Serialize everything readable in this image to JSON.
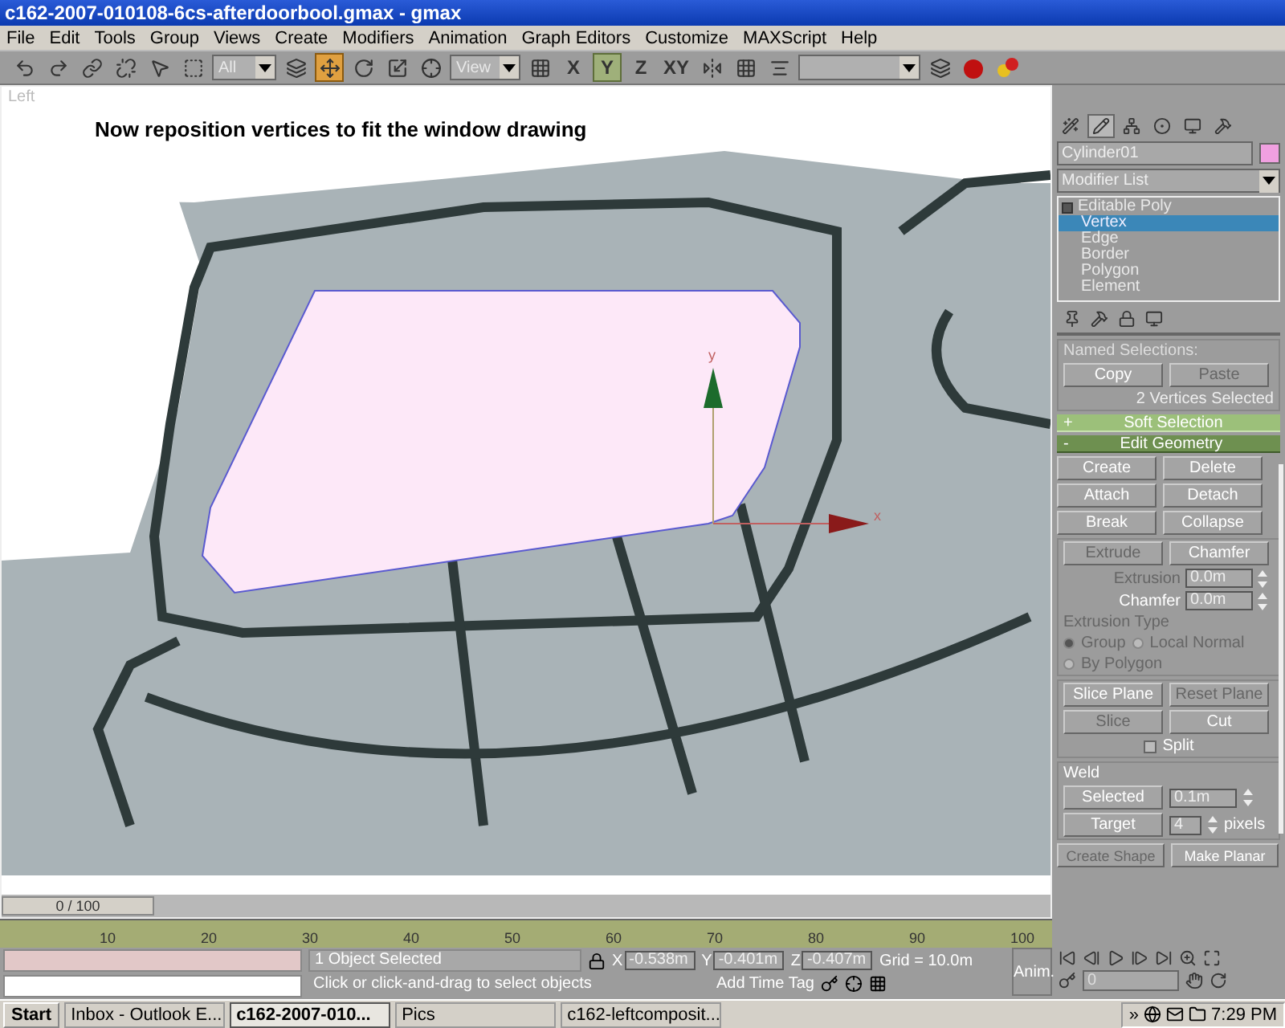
{
  "window": {
    "title": "c162-2007-010108-6cs-afterdoorbool.gmax - gmax"
  },
  "menu": [
    "File",
    "Edit",
    "Tools",
    "Group",
    "Views",
    "Create",
    "Modifiers",
    "Animation",
    "Graph Editors",
    "Customize",
    "MAXScript",
    "Help"
  ],
  "toolbar": {
    "selection_filter": "All",
    "reference_coord": "View",
    "transform_tools": [
      {
        "kind": "select",
        "selected": false
      },
      {
        "kind": "region",
        "selected": false
      },
      {
        "kind": "move",
        "selected": true
      },
      {
        "kind": "rotate",
        "selected": false
      },
      {
        "kind": "scale",
        "selected": false
      }
    ],
    "axis_constraints": [
      {
        "label": "X",
        "selected": false
      },
      {
        "label": "Y",
        "selected": true
      },
      {
        "label": "Z",
        "selected": false
      },
      {
        "label": "XY",
        "selected": false
      }
    ]
  },
  "viewport": {
    "label": "Left",
    "annotation": "Now reposition vertices to fit the window drawing",
    "gizmo_axes": [
      "y",
      "x"
    ],
    "time_slider": {
      "label": "0 / 100",
      "level": 0
    }
  },
  "command_panel": {
    "tabs": [
      {
        "kind": "create",
        "selected": false
      },
      {
        "kind": "modify",
        "selected": true
      },
      {
        "kind": "hierarchy",
        "selected": false
      },
      {
        "kind": "motion",
        "selected": false
      },
      {
        "kind": "display",
        "selected": false
      },
      {
        "kind": "utilities",
        "selected": false
      }
    ],
    "object_name": "Cylinder01",
    "modifier_list": "Modifier List",
    "stack": [
      {
        "label": "Editable Poly",
        "expanded": true,
        "children": [
          {
            "label": "Vertex",
            "selected": true
          },
          {
            "label": "Edge",
            "selected": false
          },
          {
            "label": "Border",
            "selected": false
          },
          {
            "label": "Polygon",
            "selected": false
          },
          {
            "label": "Element",
            "selected": false
          }
        ]
      }
    ],
    "named_selections": {
      "title": "Named Selections:",
      "buttons": [
        {
          "label": "Copy",
          "disabled": false
        },
        {
          "label": "Paste",
          "disabled": true
        }
      ],
      "status": "2 Vertices Selected"
    },
    "rollouts": [
      {
        "toggle": "+",
        "label": "Soft Selection",
        "expanded": false
      },
      {
        "toggle": "-",
        "label": "Edit Geometry",
        "expanded": true
      }
    ],
    "edit_geometry": {
      "button_rows": [
        [
          {
            "label": "Create",
            "disabled": false
          },
          {
            "label": "Delete",
            "disabled": false
          }
        ],
        [
          {
            "label": "Attach",
            "disabled": false
          },
          {
            "label": "Detach",
            "disabled": false
          }
        ],
        [
          {
            "label": "Break",
            "disabled": false
          },
          {
            "label": "Collapse",
            "disabled": false
          }
        ]
      ],
      "extrude_buttons": [
        {
          "label": "Extrude",
          "disabled": true
        },
        {
          "label": "Chamfer",
          "disabled": false
        }
      ],
      "spinners": [
        {
          "label": "Extrusion",
          "value": "0.0m",
          "disabled": true
        },
        {
          "label": "Chamfer",
          "value": "0.0m",
          "disabled": false
        }
      ],
      "extrusion_type": {
        "label": "Extrusion Type",
        "disabled": true,
        "options": [
          {
            "label": "Group",
            "selected": true
          },
          {
            "label": "Local Normal",
            "selected": false
          },
          {
            "label": "By Polygon",
            "selected": false
          }
        ]
      },
      "slice_rows": [
        [
          {
            "label": "Slice Plane",
            "disabled": false
          },
          {
            "label": "Reset Plane",
            "disabled": true
          }
        ],
        [
          {
            "label": "Slice",
            "disabled": true
          },
          {
            "label": "Cut",
            "disabled": false
          }
        ]
      ],
      "split": {
        "label": "Split",
        "checked": false
      },
      "weld": {
        "title": "Weld",
        "selected_button": "Selected",
        "selected_value": "0.1m",
        "target_button": "Target",
        "target_value": "4",
        "target_unit": "pixels"
      },
      "bottom_buttons": [
        {
          "label": "Create Shape",
          "disabled": true
        },
        {
          "label": "Make Planar",
          "disabled": false
        }
      ]
    }
  },
  "timeline": {
    "ticks": [
      "10",
      "20",
      "30",
      "40",
      "50",
      "60",
      "70",
      "80",
      "90",
      "100"
    ]
  },
  "status": {
    "selection": "1 Object Selected",
    "prompt": "Click or click-and-drag to select objects",
    "coords": [
      {
        "axis": "X",
        "value": "-0.538m"
      },
      {
        "axis": "Y",
        "value": "-0.401m"
      },
      {
        "axis": "Z",
        "value": "-0.407m"
      }
    ],
    "grid": "Grid = 10.0m",
    "add_time_tag": "Add Time Tag",
    "anim": "Anim.",
    "frame": "0"
  },
  "taskbar": {
    "start": "Start",
    "items": [
      {
        "label": "Inbox - Outlook E...",
        "selected": false
      },
      {
        "label": "c162-2007-010...",
        "selected": true
      },
      {
        "label": "Pics",
        "selected": false
      },
      {
        "label": "c162-leftcomposit...",
        "selected": false
      }
    ],
    "chevron": "»",
    "clock": "7:29 PM"
  }
}
